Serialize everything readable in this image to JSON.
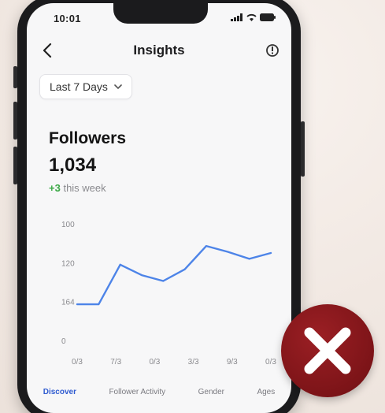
{
  "status": {
    "time": "10:01"
  },
  "nav": {
    "title": "Insights",
    "back_icon": "chevron-left-icon",
    "action_icon": "info-icon"
  },
  "filter": {
    "selected": "Last 7 Days",
    "icon": "chevron-down-icon"
  },
  "metric": {
    "title": "Followers",
    "value": "1,034",
    "delta_value": "+3",
    "delta_label": "this week"
  },
  "tabs": [
    {
      "label": "Discover"
    },
    {
      "label": "Follower Activity"
    },
    {
      "label": "Gender"
    },
    {
      "label": "Ages"
    }
  ],
  "colors": {
    "accent": "#4d84e8",
    "positive": "#3aa845",
    "close_badge": "#7d1418"
  },
  "overlay": {
    "icon": "close-x-icon"
  },
  "chart_data": {
    "type": "line",
    "title": "",
    "xlabel": "",
    "ylabel": "",
    "x": [
      "0/3",
      "7/3",
      "0/3",
      "3/3",
      "9/3",
      "0/3"
    ],
    "y_tick_labels": [
      "0",
      "164",
      "120",
      "100"
    ],
    "series": [
      {
        "values": [
          62,
          62,
          130,
          112,
          102,
          122,
          162,
          152,
          140,
          150
        ]
      }
    ],
    "ylim": [
      0,
      200
    ],
    "grid": false,
    "legend": "none"
  }
}
